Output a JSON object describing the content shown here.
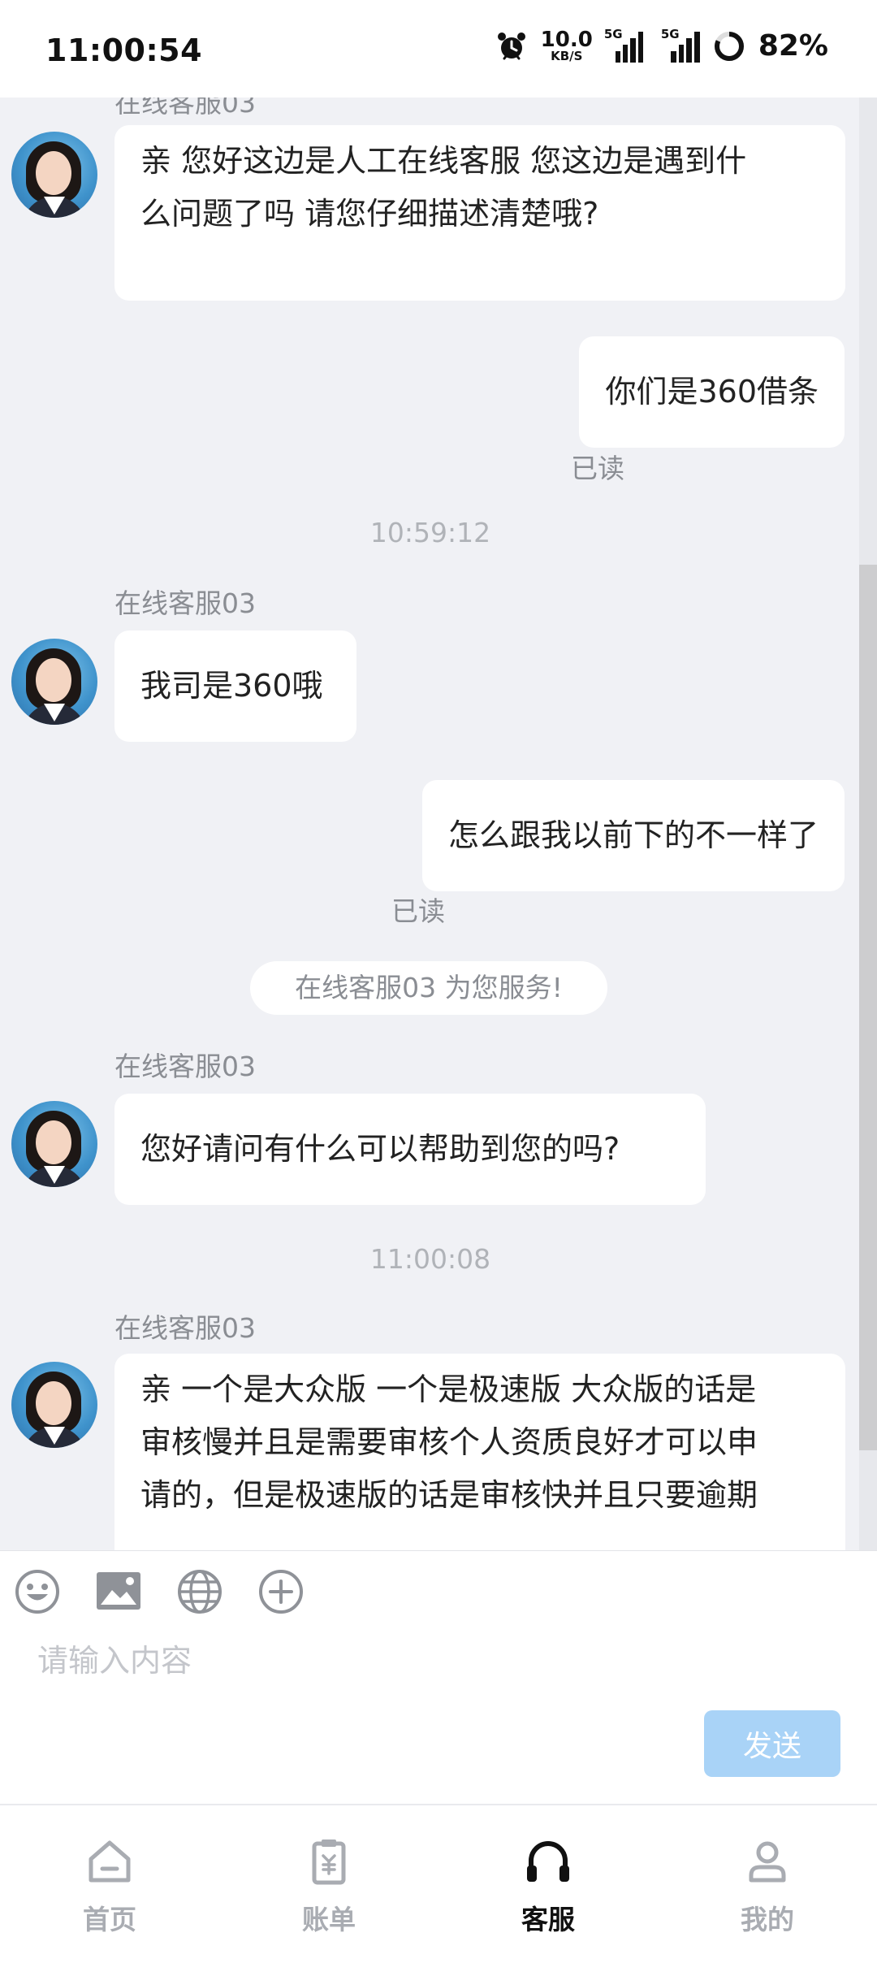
{
  "status_bar": {
    "time": "11:00:54",
    "net_speed": "10.0",
    "net_speed_unit": "KB/S",
    "sim1_label": "5G",
    "sim2_label": "5G",
    "battery": "82%"
  },
  "chat": {
    "partial_top_name": "在线客服03",
    "messages": [
      {
        "side": "in",
        "text_line1": "亲 您好这边是人工在线客服  您这边是遇到什",
        "text_line2": "么问题了吗 请您仔细描述清楚哦?"
      },
      {
        "side": "out",
        "text": "你们是360借条",
        "read": "已读"
      },
      {
        "timestamp": "10:59:12"
      },
      {
        "side": "in",
        "name": "在线客服03",
        "text": "我司是360哦"
      },
      {
        "side": "out",
        "text": "怎么跟我以前下的不一样了",
        "read": "已读"
      },
      {
        "system": "在线客服03 为您服务!"
      },
      {
        "side": "in",
        "name": "在线客服03",
        "text": "您好请问有什么可以帮助到您的吗?"
      },
      {
        "timestamp": "11:00:08"
      },
      {
        "side": "in",
        "name": "在线客服03",
        "text_line1": "亲 一个是大众版 一个是极速版 大众版的话是",
        "text_line2": "审核慢并且是需要审核个人资质良好才可以申",
        "text_line3": "请的，但是极速版的话是审核快并且只要逾期"
      }
    ]
  },
  "input": {
    "placeholder": "请输入内容",
    "send_label": "发送",
    "tools": [
      "emoji-icon",
      "image-icon",
      "globe-icon",
      "plus-circle-icon"
    ]
  },
  "nav": {
    "items": [
      {
        "label": "首页",
        "icon": "home-icon",
        "active": false
      },
      {
        "label": "账单",
        "icon": "bill-icon",
        "active": false
      },
      {
        "label": "客服",
        "icon": "headset-icon",
        "active": true
      },
      {
        "label": "我的",
        "icon": "profile-icon",
        "active": false
      }
    ]
  },
  "colors": {
    "background": "#f0f1f5",
    "bubble": "#ffffff",
    "send_button": "#a9d3f7",
    "nav_active": "#111111",
    "nav_inactive": "#a9acb2"
  }
}
